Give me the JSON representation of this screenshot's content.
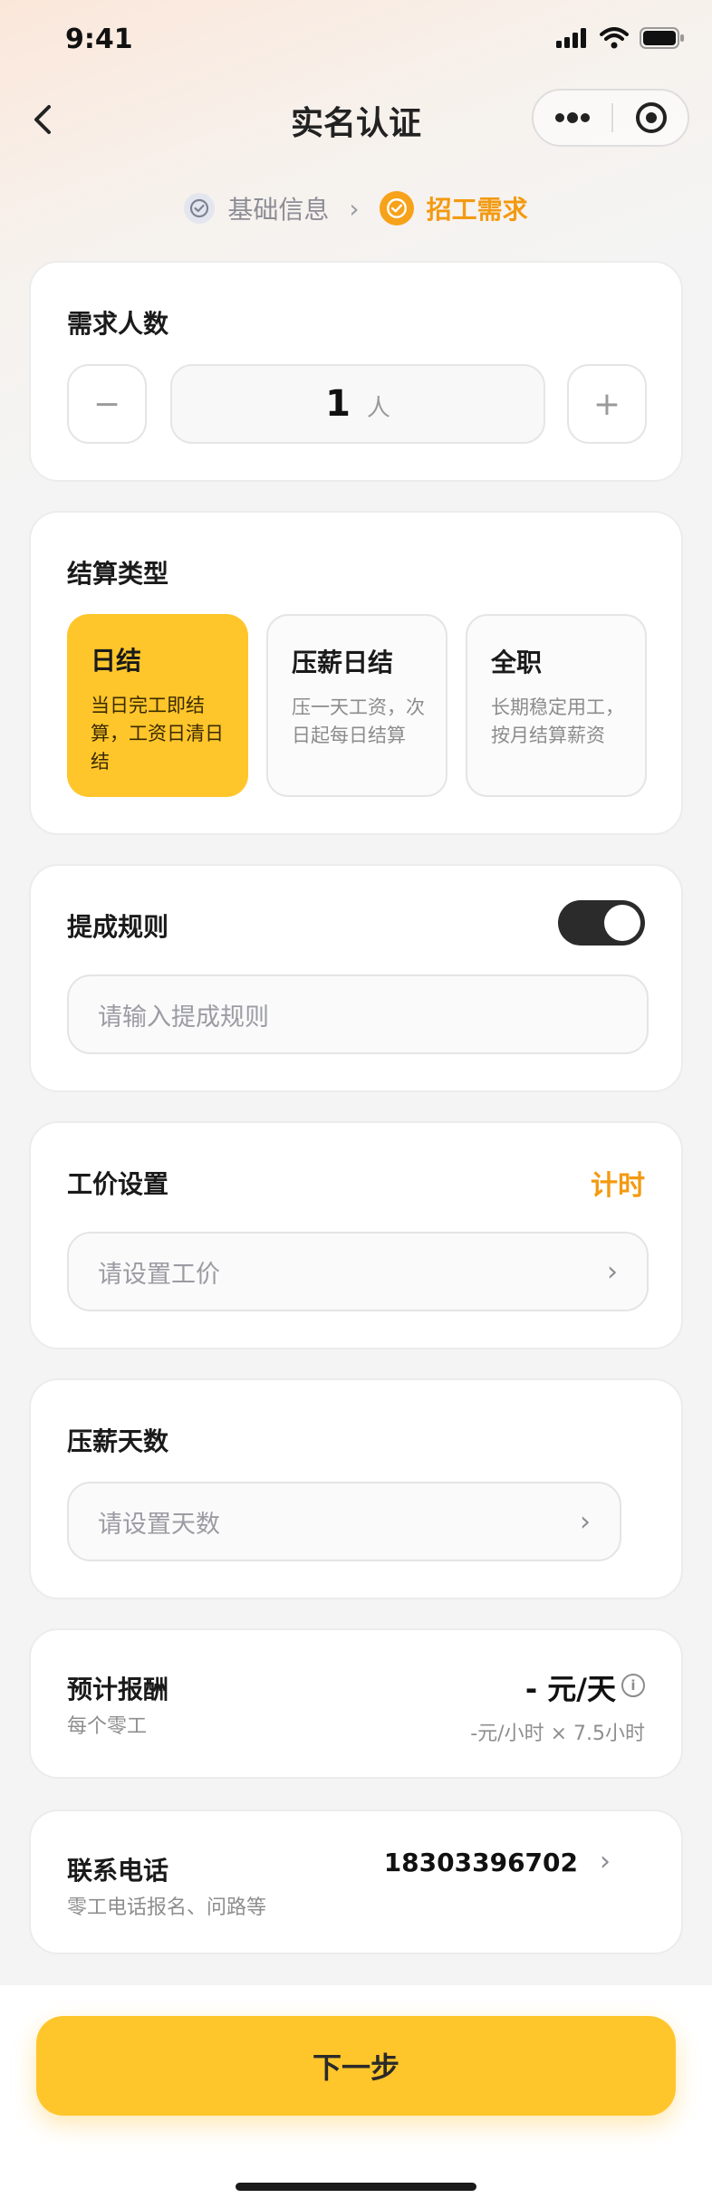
{
  "status_bar": {
    "time": "9:41"
  },
  "nav": {
    "title": "实名认证"
  },
  "steps": {
    "step1": "基础信息",
    "step2": "招工需求"
  },
  "headcount": {
    "title": "需求人数",
    "value": "1",
    "unit": "人",
    "minus": "−",
    "plus": "+"
  },
  "settlement": {
    "title": "结算类型",
    "options": [
      {
        "title": "日结",
        "desc": "当日完工即结算，工资日清日结"
      },
      {
        "title": "压薪日结",
        "desc": "压一天工资，次日起每日结算"
      },
      {
        "title": "全职",
        "desc": "长期稳定用工，按月结算薪资"
      }
    ],
    "selected": "日结"
  },
  "commission": {
    "title": "提成规则",
    "enabled": true,
    "placeholder": "请输入提成规则"
  },
  "wage": {
    "title": "工价设置",
    "mode": "计时",
    "placeholder": "请设置工价"
  },
  "hold_days": {
    "title": "压薪天数",
    "placeholder": "请设置天数"
  },
  "estimate": {
    "title": "预计报酬",
    "subtitle": "每个零工",
    "amount": "- 元/天",
    "detail": "-元/小时 × 7.5小时"
  },
  "contact": {
    "title": "联系电话",
    "subtitle": "零工电话报名、问路等",
    "phone": "18303396702"
  },
  "footer": {
    "next_label": "下一步"
  },
  "colors": {
    "accent": "#ffc62b",
    "orange": "#f39a11"
  }
}
